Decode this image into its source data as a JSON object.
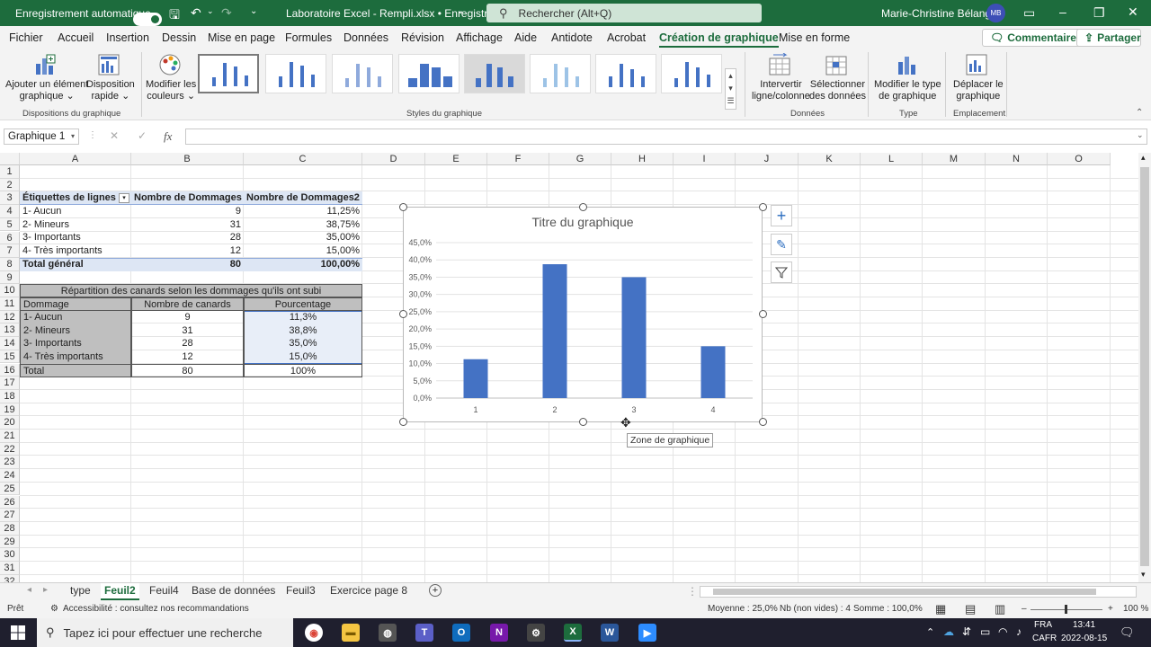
{
  "titlebar": {
    "autosave_label": "Enregistrement automatique",
    "file_name": "Laboratoire Excel - Rempli.xlsx • Enregistré",
    "search_placeholder": "Rechercher (Alt+Q)",
    "user_name": "Marie-Christine Bélanger",
    "user_initials": "MB"
  },
  "menu": {
    "items": [
      "Fichier",
      "Accueil",
      "Insertion",
      "Dessin",
      "Mise en page",
      "Formules",
      "Données",
      "Révision",
      "Affichage",
      "Aide",
      "Antidote",
      "Acrobat",
      "Création de graphique",
      "Mise en forme"
    ],
    "active": "Création de graphique",
    "comments_label": "Commentaires",
    "share_label": "Partager"
  },
  "ribbon": {
    "add_element": [
      "Ajouter un élément",
      "graphique"
    ],
    "quick_layout": [
      "Disposition",
      "rapide"
    ],
    "change_colors": [
      "Modifier les",
      "couleurs"
    ],
    "switch_row_col": [
      "Intervertir",
      "ligne/colonne"
    ],
    "select_data": [
      "Sélectionner",
      "des données"
    ],
    "change_type": [
      "Modifier le type",
      "de graphique"
    ],
    "move_chart": [
      "Déplacer le",
      "graphique"
    ],
    "groups": {
      "layouts": "Dispositions du graphique",
      "styles": "Styles du graphique",
      "data": "Données",
      "type": "Type",
      "location": "Emplacement"
    }
  },
  "formula_bar": {
    "name_box": "Graphique 1",
    "fx": "fx",
    "formula": ""
  },
  "columns": [
    "A",
    "B",
    "C",
    "D",
    "E",
    "F",
    "G",
    "H",
    "I",
    "J",
    "K",
    "L",
    "M",
    "N",
    "O"
  ],
  "rows": [
    "1",
    "2",
    "3",
    "4",
    "5",
    "6",
    "7",
    "8",
    "9",
    "10",
    "11",
    "12",
    "13",
    "14",
    "15",
    "16",
    "17",
    "18",
    "19",
    "20",
    "21",
    "22",
    "23",
    "24",
    "25",
    "26",
    "27",
    "28",
    "29",
    "30",
    "31",
    "32"
  ],
  "pivot": {
    "header": [
      "Étiquettes de lignes",
      "Nombre de Dommages",
      "Nombre de Dommages2"
    ],
    "rows": [
      [
        "1- Aucun",
        "9",
        "11,25%"
      ],
      [
        "2- Mineurs",
        "31",
        "38,75%"
      ],
      [
        "3- Importants",
        "28",
        "35,00%"
      ],
      [
        "4- Très importants",
        "12",
        "15,00%"
      ]
    ],
    "total": [
      "Total général",
      "80",
      "100,00%"
    ]
  },
  "table2": {
    "title": "Répartition des canards selon les dommages qu'ils ont subi",
    "header": [
      "Dommage",
      "Nombre de canards",
      "Pourcentage"
    ],
    "rows": [
      [
        "1- Aucun",
        "9",
        "11,3%"
      ],
      [
        "2- Mineurs",
        "31",
        "38,8%"
      ],
      [
        "3- Importants",
        "28",
        "35,0%"
      ],
      [
        "4- Très importants",
        "12",
        "15,0%"
      ]
    ],
    "total": [
      "Total",
      "80",
      "100%"
    ]
  },
  "chart_data": {
    "type": "bar",
    "title": "Titre du graphique",
    "categories": [
      "1",
      "2",
      "3",
      "4"
    ],
    "values": [
      11.25,
      38.75,
      35.0,
      15.0
    ],
    "y_ticks": [
      "0,0%",
      "5,0%",
      "10,0%",
      "15,0%",
      "20,0%",
      "25,0%",
      "30,0%",
      "35,0%",
      "40,0%",
      "45,0%"
    ],
    "ylim": [
      0,
      45
    ],
    "grid": true,
    "bar_color": "#4472c4"
  },
  "chart_tooltip": "Zone de graphique",
  "sheets": {
    "tabs": [
      "type",
      "Feuil2",
      "Feuil4",
      "Base de données",
      "Feuil3",
      "Exercice page 8"
    ],
    "active": "Feuil2"
  },
  "status": {
    "ready": "Prêt",
    "accessibility": "Accessibilité : consultez nos recommandations",
    "average": "Moyenne : 25,0%",
    "count": "Nb (non vides) : 4",
    "sum": "Somme : 100,0%",
    "zoom": "100 %"
  },
  "taskbar": {
    "search_placeholder": "Tapez ici pour effectuer une recherche",
    "lang1": "FRA",
    "lang2": "CAFR",
    "time": "13:41",
    "date": "2022-08-15"
  },
  "colors": {
    "excel_green": "#1d6c3d",
    "bar": "#4472c4",
    "pivot_header": "#dde6f4",
    "table_gray": "#bfbfbf"
  }
}
